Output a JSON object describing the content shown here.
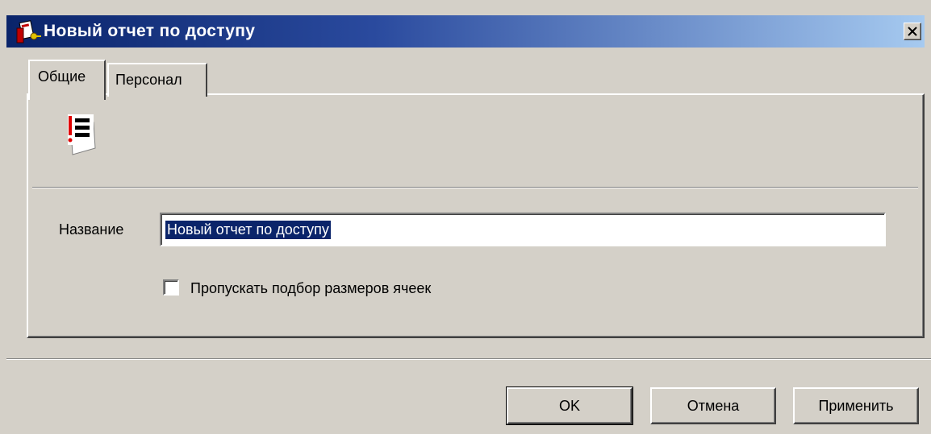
{
  "window": {
    "title": "Новый отчет по доступу",
    "icons": {
      "app": "key-card-icon",
      "close": "close-icon",
      "report": "report-list-icon"
    }
  },
  "tabs": [
    {
      "label": "Общие",
      "active": true
    },
    {
      "label": "Персонал",
      "active": false
    }
  ],
  "form": {
    "name_label": "Название",
    "name_value": "Новый отчет по доступу",
    "skip_cell_fit_label": "Пропускать подбор размеров ячеек",
    "skip_cell_fit_checked": false
  },
  "buttons": {
    "ok": "OK",
    "cancel": "Отмена",
    "apply": "Применить"
  },
  "colors": {
    "titlebar_start": "#0a246a",
    "titlebar_end": "#a6caf0",
    "face": "#d4d0c8",
    "selection": "#0a246a"
  }
}
